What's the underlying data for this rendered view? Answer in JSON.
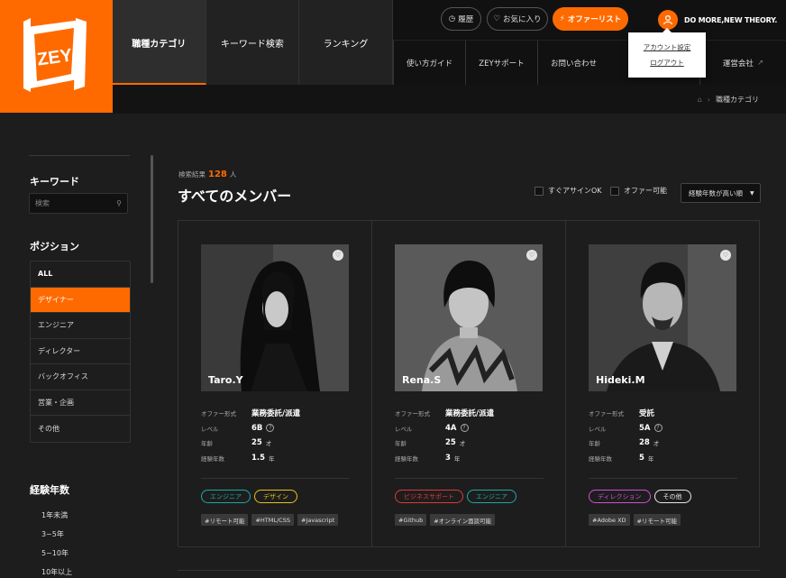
{
  "brand": {
    "logo_text": "ZEY",
    "tagline": "DO MORE,NEW THEORY.",
    "accent": "#ff6a00"
  },
  "nav": {
    "tabs": [
      {
        "label": "職種カテゴリ"
      },
      {
        "label": "キーワード検索"
      },
      {
        "label": "ランキング"
      }
    ],
    "actions": {
      "history": "履歴",
      "favorites": "お気に入り",
      "offer_list": "オファーリスト"
    },
    "sub": [
      "使い方ガイド",
      "ZEYサポート",
      "お問い合わせ",
      "運営会社"
    ]
  },
  "account_menu": {
    "settings": "アカウント設定",
    "logout": "ログアウト"
  },
  "breadcrumb": {
    "current": "職種カテゴリ"
  },
  "sidebar": {
    "keyword_heading": "キーワード",
    "search_placeholder": "検索",
    "position_heading": "ポジション",
    "positions": [
      "ALL",
      "デザイナー",
      "エンジニア",
      "ディレクター",
      "バックオフィス",
      "営業・企画",
      "その他"
    ],
    "experience_heading": "経験年数",
    "years": [
      "1年未満",
      "3~5年",
      "5~10年",
      "10年以上"
    ]
  },
  "results": {
    "label": "検索結果",
    "count": "128",
    "unit": "人",
    "title": "すべてのメンバー",
    "filter_assign": "すぐアサインOK",
    "filter_offer": "オファー可能",
    "sort": "経験年数が高い順"
  },
  "spec_labels": {
    "form": "オファー形式",
    "level": "レベル",
    "age": "年齢",
    "exp": "経験年数",
    "age_unit": "才",
    "exp_unit": "年"
  },
  "members": [
    {
      "name": "Taro.Y",
      "form": "業務委託/派遣",
      "level": "6B",
      "age": "25",
      "exp": "1.5",
      "tags": [
        {
          "label": "エンジニア",
          "color": "#1fa8a8"
        },
        {
          "label": "デザイン",
          "color": "#e8c21a"
        }
      ],
      "hashtags": [
        "#リモート可能",
        "#HTML/CSS",
        "#Javascript"
      ]
    },
    {
      "name": "Rena.S",
      "form": "業務委託/派遣",
      "level": "4A",
      "age": "25",
      "exp": "3",
      "tags": [
        {
          "label": "ビジネスサポート",
          "color": "#e0393b"
        },
        {
          "label": "エンジニア",
          "color": "#1fa8a8"
        }
      ],
      "hashtags": [
        "#Github",
        "#オンライン面談可能"
      ]
    },
    {
      "name": "Hideki.M",
      "form": "受託",
      "level": "5A",
      "age": "28",
      "exp": "5",
      "tags": [
        {
          "label": "ディレクション",
          "color": "#d04fd4"
        },
        {
          "label": "その他",
          "color": "#e8e8e8"
        }
      ],
      "hashtags": [
        "#Adobe XD",
        "#リモート可能"
      ]
    }
  ]
}
